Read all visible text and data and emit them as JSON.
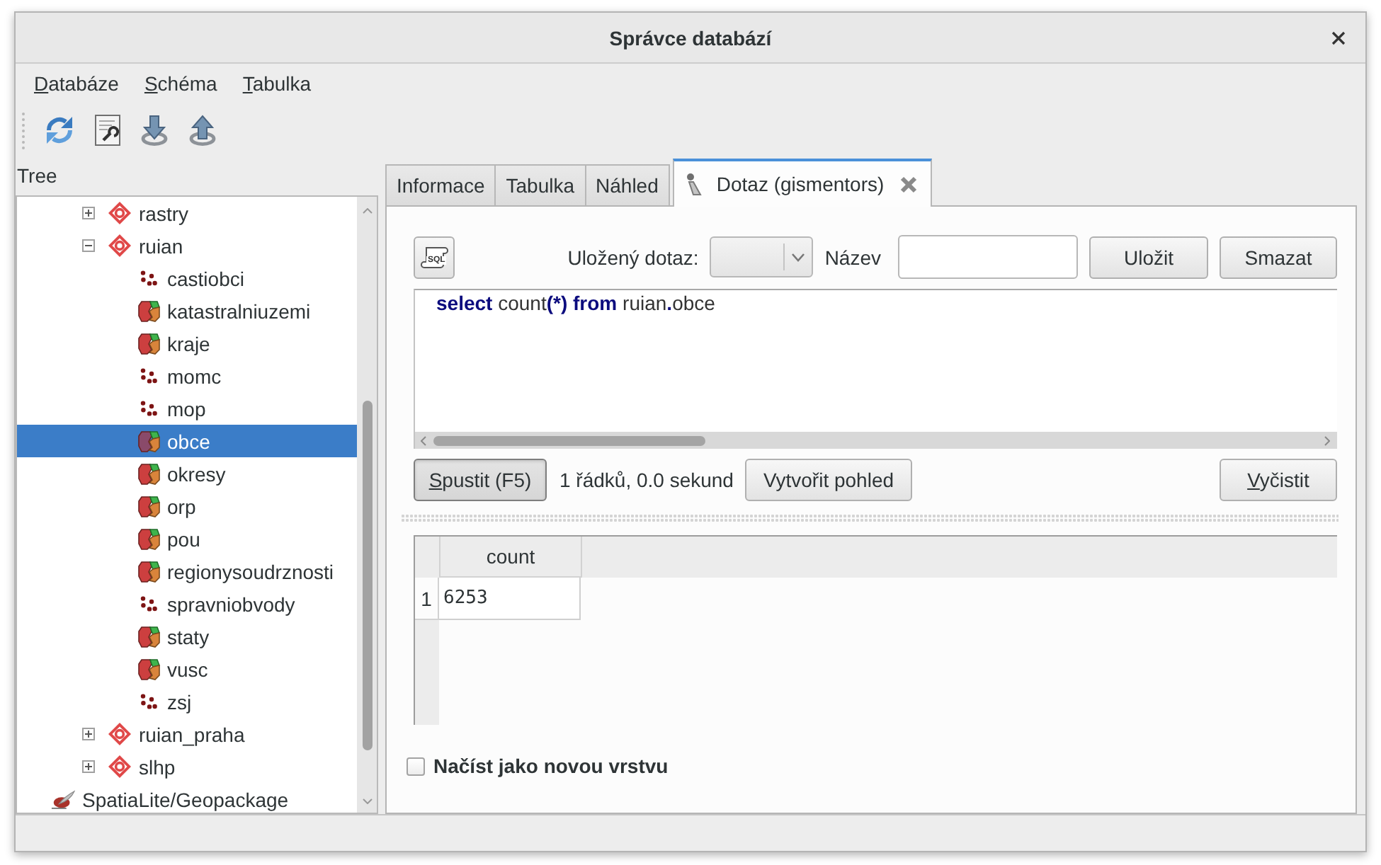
{
  "window": {
    "title": "Správce databází"
  },
  "menu": [
    "Databáze",
    "Schéma",
    "Tabulka"
  ],
  "tree": {
    "title": "Tree",
    "items": [
      {
        "children": [
          {
            "children": [
              {
                "label": "rastry",
                "kind": "schema",
                "expanded": false,
                "selected": false
              },
              {
                "label": "ruian",
                "kind": "schema",
                "expanded": true,
                "selected": false,
                "children": [
                  {
                    "label": "castiobci",
                    "kind": "points",
                    "selected": false
                  },
                  {
                    "label": "katastralniuzemi",
                    "kind": "polygons",
                    "selected": false
                  },
                  {
                    "label": "kraje",
                    "kind": "polygons",
                    "selected": false
                  },
                  {
                    "label": "momc",
                    "kind": "points",
                    "selected": false
                  },
                  {
                    "label": "mop",
                    "kind": "points",
                    "selected": false
                  },
                  {
                    "label": "obce",
                    "kind": "polygons",
                    "selected": true
                  },
                  {
                    "label": "okresy",
                    "kind": "polygons",
                    "selected": false
                  },
                  {
                    "label": "orp",
                    "kind": "polygons",
                    "selected": false
                  },
                  {
                    "label": "pou",
                    "kind": "polygons",
                    "selected": false
                  },
                  {
                    "label": "regionysoudrznosti",
                    "kind": "polygons",
                    "selected": false
                  },
                  {
                    "label": "spravniobvody",
                    "kind": "points",
                    "selected": false
                  },
                  {
                    "label": "staty",
                    "kind": "polygons",
                    "selected": false
                  },
                  {
                    "label": "vusc",
                    "kind": "polygons",
                    "selected": false
                  },
                  {
                    "label": "zsj",
                    "kind": "points",
                    "selected": false
                  }
                ]
              },
              {
                "label": "ruian_praha",
                "kind": "schema",
                "expanded": false,
                "selected": false
              },
              {
                "label": "slhp",
                "kind": "schema",
                "expanded": false,
                "selected": false
              }
            ]
          }
        ]
      },
      {
        "label": "SpatiaLite/Geopackage",
        "kind": "provider",
        "selected": false
      }
    ]
  },
  "tabs": [
    {
      "label": "Informace",
      "kind": "fixed",
      "selected": false
    },
    {
      "label": "Tabulka",
      "kind": "fixed",
      "selected": false
    },
    {
      "label": "Náhled",
      "kind": "fixed",
      "selected": false
    },
    {
      "label": "Dotaz (gismentors)",
      "kind": "query",
      "selected": true
    }
  ],
  "query": {
    "sql_button": "SQL",
    "saved_query_label": "Uložený dotaz:",
    "name_label": "Název",
    "save_button": "Uložit",
    "delete_button": "Smazat",
    "sql": "**select** count**(*)** **from** ruian**.**obce",
    "run_button": "Spustit (F5)",
    "status": "1 řádků, 0.0 sekund",
    "create_view_button": "Vytvořit pohled",
    "clear_button": "Vyčistit"
  },
  "results": {
    "columns": [
      "count"
    ],
    "rows": [
      {
        "number": "1",
        "cells": [
          "6253"
        ]
      }
    ]
  },
  "load_as_layer": {
    "label": "Načíst jako novou vrstvu",
    "checked": false
  }
}
